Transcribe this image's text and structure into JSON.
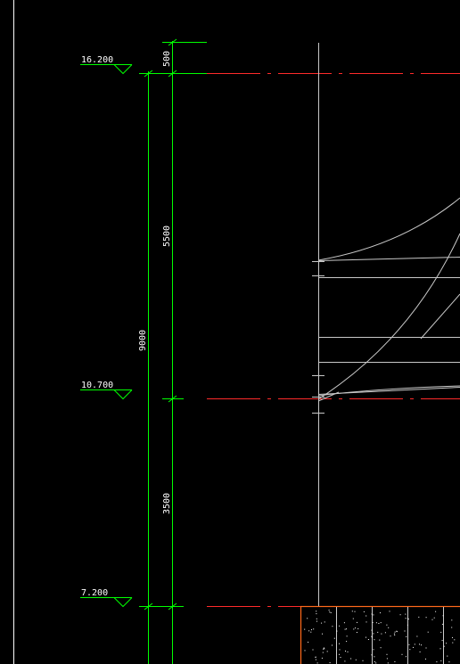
{
  "drawing": {
    "elevations": [
      {
        "label": "16.200"
      },
      {
        "label": "10.700"
      },
      {
        "label": "7.200"
      }
    ],
    "dimensions": {
      "inner": [
        "500",
        "5500",
        "3500"
      ],
      "total": "9000"
    },
    "colors": {
      "background": "#000000",
      "dimension_lines": "#00ff00",
      "axis_lines": "#ff2a2a",
      "structure": "#c8c8c8",
      "text": "#ffffff",
      "foundation": "#ff6a1a"
    }
  }
}
